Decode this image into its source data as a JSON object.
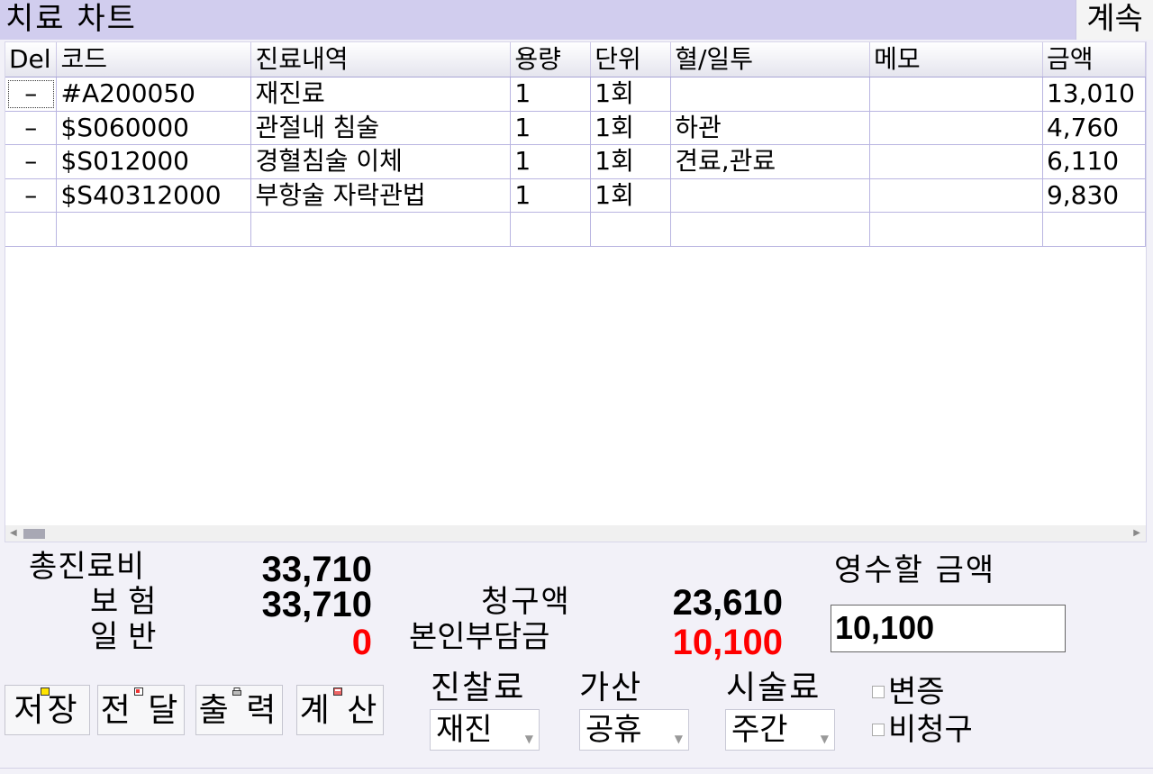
{
  "header": {
    "title": "치료 차트",
    "continue_button": "계속"
  },
  "grid": {
    "columns": [
      "Del",
      "코드",
      "진료내역",
      "용량",
      "단위",
      "혈/일투",
      "메모",
      "금액"
    ],
    "rows": [
      [
        "–",
        "#A200050",
        "재진료",
        "1",
        "1회",
        "",
        "",
        "13,010"
      ],
      [
        "–",
        "$S060000",
        "관절내 침술",
        "1",
        "1회",
        "하관",
        "",
        "4,760"
      ],
      [
        "–",
        "$S012000",
        "경혈침술 이체",
        "1",
        "1회",
        "견료,관료",
        "",
        "6,110"
      ],
      [
        "–",
        "$S40312000",
        "부항술 자락관법",
        "1",
        "1회",
        "",
        "",
        "9,830"
      ],
      [
        "",
        "",
        "",
        "",
        "",
        "",
        "",
        ""
      ]
    ]
  },
  "summary": {
    "total_label": "총진료비",
    "total_value": "33,710",
    "insurance_label": "보 험",
    "insurance_value": "33,710",
    "general_label": "일 반",
    "general_value": "0",
    "claim_label": "청구액",
    "claim_value": "23,610",
    "copay_label": "본인부담금",
    "copay_value": "10,100",
    "receipt_label": "영수할 금액",
    "receipt_value": "10,100"
  },
  "buttons": {
    "save": "저장",
    "transfer": "전 달",
    "print": "출 력",
    "calculate": "계 산"
  },
  "selects": {
    "exam_fee_label": "진찰료",
    "exam_fee_value": "재진",
    "surcharge_label": "가산",
    "surcharge_value": "공휴",
    "procedure_fee_label": "시술료",
    "procedure_fee_value": "주간"
  },
  "checkboxes": {
    "certificate": "변증",
    "non_claim": "비청구"
  },
  "colors": {
    "title_bar": "#d1cdee",
    "negative": "#ff0000",
    "grid_line": "#b9b5e1"
  }
}
